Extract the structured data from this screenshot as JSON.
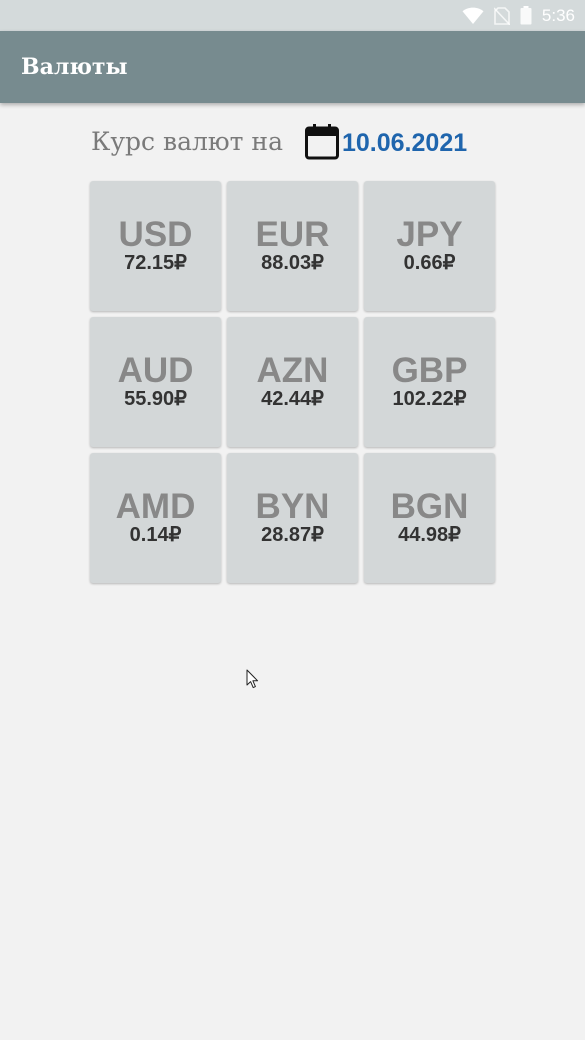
{
  "status_bar": {
    "time": "5:36",
    "icons": [
      "wifi-icon",
      "no-sim-icon",
      "battery-icon"
    ]
  },
  "app_bar": {
    "title": "Валюты"
  },
  "date_row": {
    "label": "Курс валют на",
    "date": "10.06.2021",
    "icon": "calendar-icon"
  },
  "currencies": [
    {
      "code": "USD",
      "rate": "72.15₽"
    },
    {
      "code": "EUR",
      "rate": "88.03₽"
    },
    {
      "code": "JPY",
      "rate": "0.66₽"
    },
    {
      "code": "AUD",
      "rate": "55.90₽"
    },
    {
      "code": "AZN",
      "rate": "42.44₽"
    },
    {
      "code": "GBP",
      "rate": "102.22₽"
    },
    {
      "code": "AMD",
      "rate": "0.14₽"
    },
    {
      "code": "BYN",
      "rate": "28.87₽"
    },
    {
      "code": "BGN",
      "rate": "44.98₽"
    }
  ],
  "colors": {
    "status_bar": "#d4dadb",
    "app_bar": "#778b8f",
    "background": "#f2f2f2",
    "tile": "#d3d7d8",
    "date_accent": "#1f65ad"
  }
}
